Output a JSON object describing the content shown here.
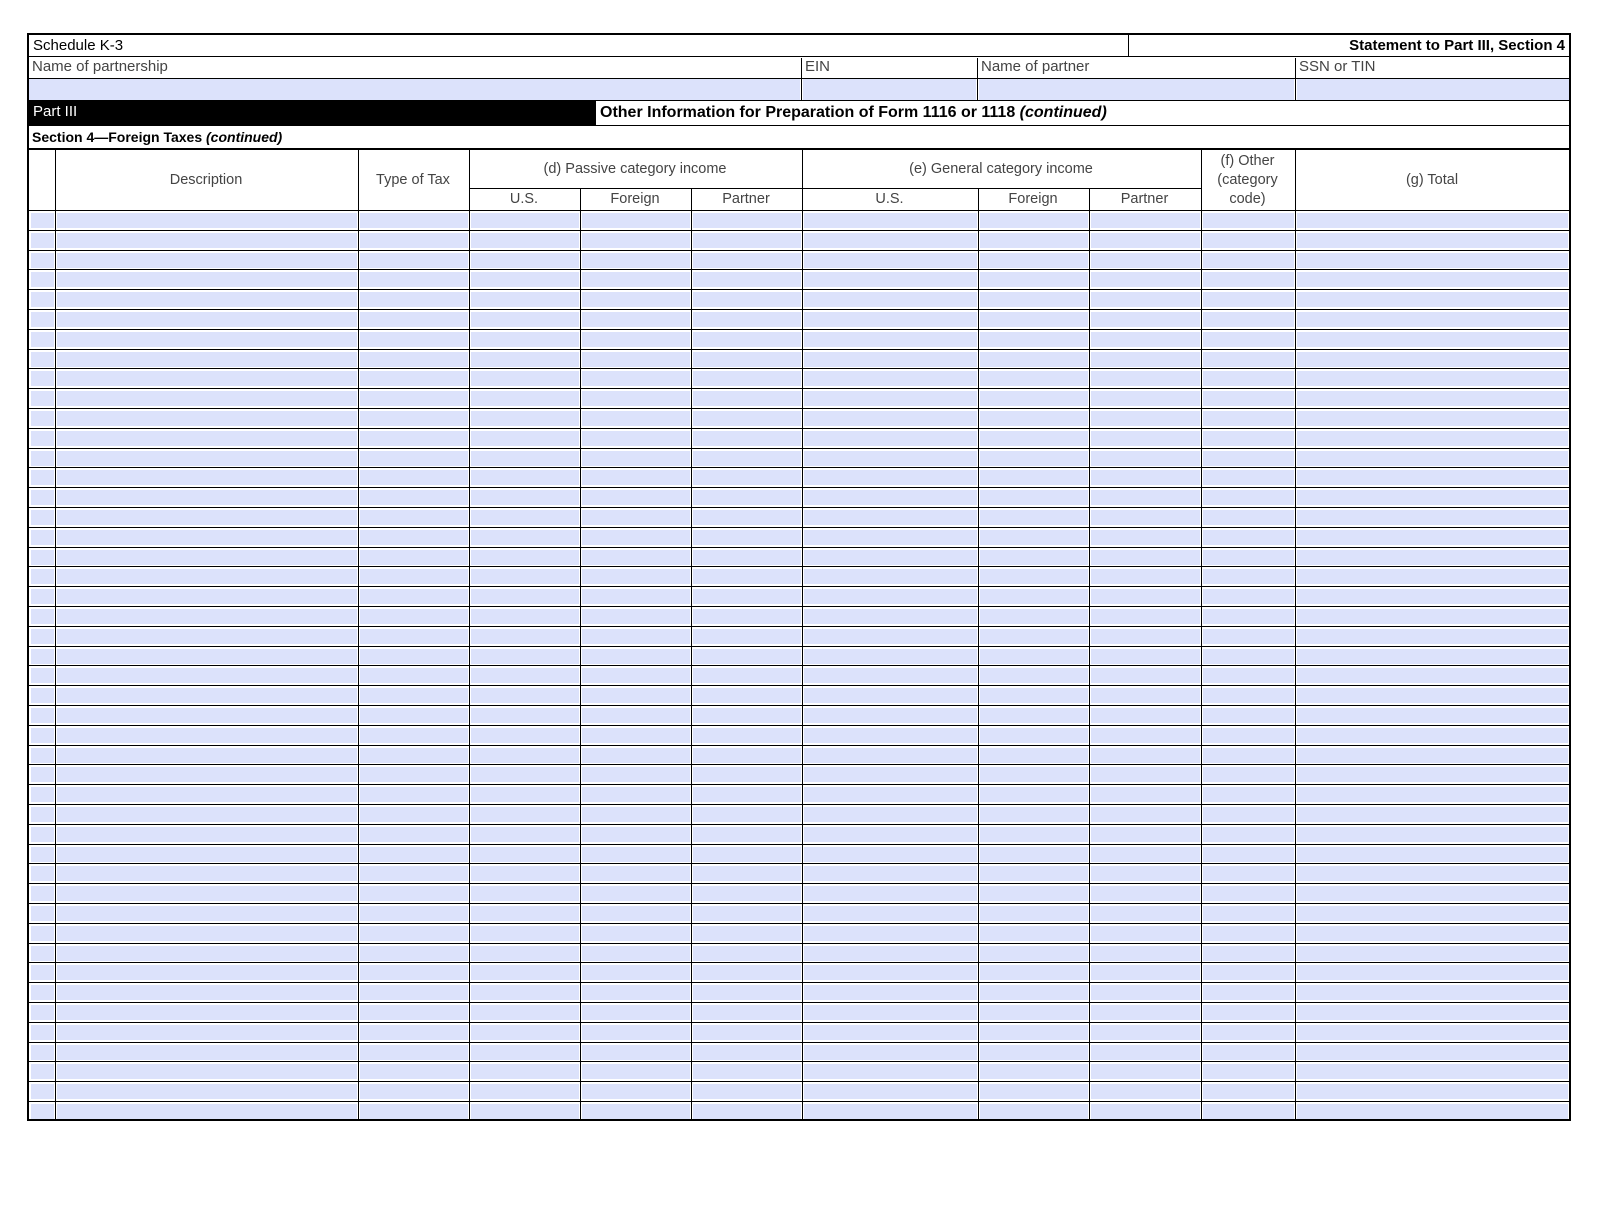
{
  "header": {
    "form_name": "Schedule K-3",
    "statement": "Statement to Part III, Section 4"
  },
  "fields": {
    "name_of_partnership": "Name of partnership",
    "ein": "EIN",
    "name_of_partner": "Name of partner",
    "ssn_or_tin": "SSN or TIN"
  },
  "part": {
    "label": "Part III",
    "title": "Other Information for Preparation of Form 1116 or 1118 ",
    "title_italic": "(continued)"
  },
  "section": {
    "title": "Section 4—Foreign Taxes ",
    "title_italic": "(continued)"
  },
  "table": {
    "columns": {
      "description": "Description",
      "type_of_tax": "Type of Tax",
      "passive_group": "(d) Passive category income",
      "general_group": "(e) General category income",
      "other": "(f) Other (category code)",
      "total": "(g) Total"
    },
    "sub": {
      "passive_us": "U.S.",
      "passive_foreign": "Foreign",
      "passive_partner": "Partner",
      "general_us": "U.S.",
      "general_foreign": "Foreign",
      "general_partner": "Partner"
    },
    "row_count": 46
  }
}
